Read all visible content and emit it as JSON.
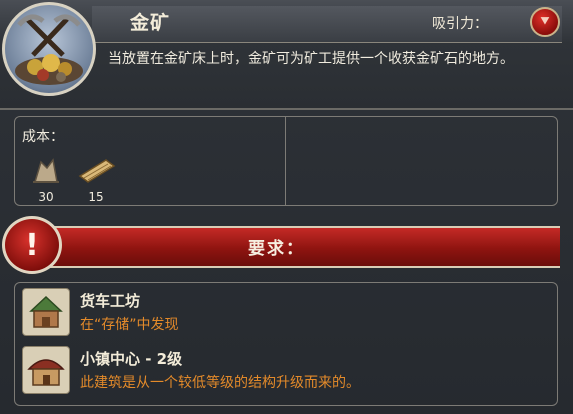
{
  "building": {
    "title": "金矿",
    "attract_label": "吸引力：",
    "description": "当放置在金矿床上时，金矿可为矿工提供一个收获金矿石的地方。",
    "icon": "gold-mine-icon"
  },
  "cost": {
    "label": "成本：",
    "resources": [
      {
        "icon": "stone-resource-icon",
        "amount": "30"
      },
      {
        "icon": "wood-planks-icon",
        "amount": "15"
      }
    ]
  },
  "requirements": {
    "title": "要求：",
    "items": [
      {
        "icon": "cart-workshop-icon",
        "name": "货车工坊",
        "note": "在“存储”中发现"
      },
      {
        "icon": "town-center-icon",
        "name": "小镇中心 - 2级",
        "note": "此建筑是从一个较低等级的结构升级而来的。"
      }
    ]
  },
  "colors": {
    "accent_red": "#b11c17",
    "note_orange": "#e38a2a",
    "panel_dark": "#2a2e33"
  }
}
